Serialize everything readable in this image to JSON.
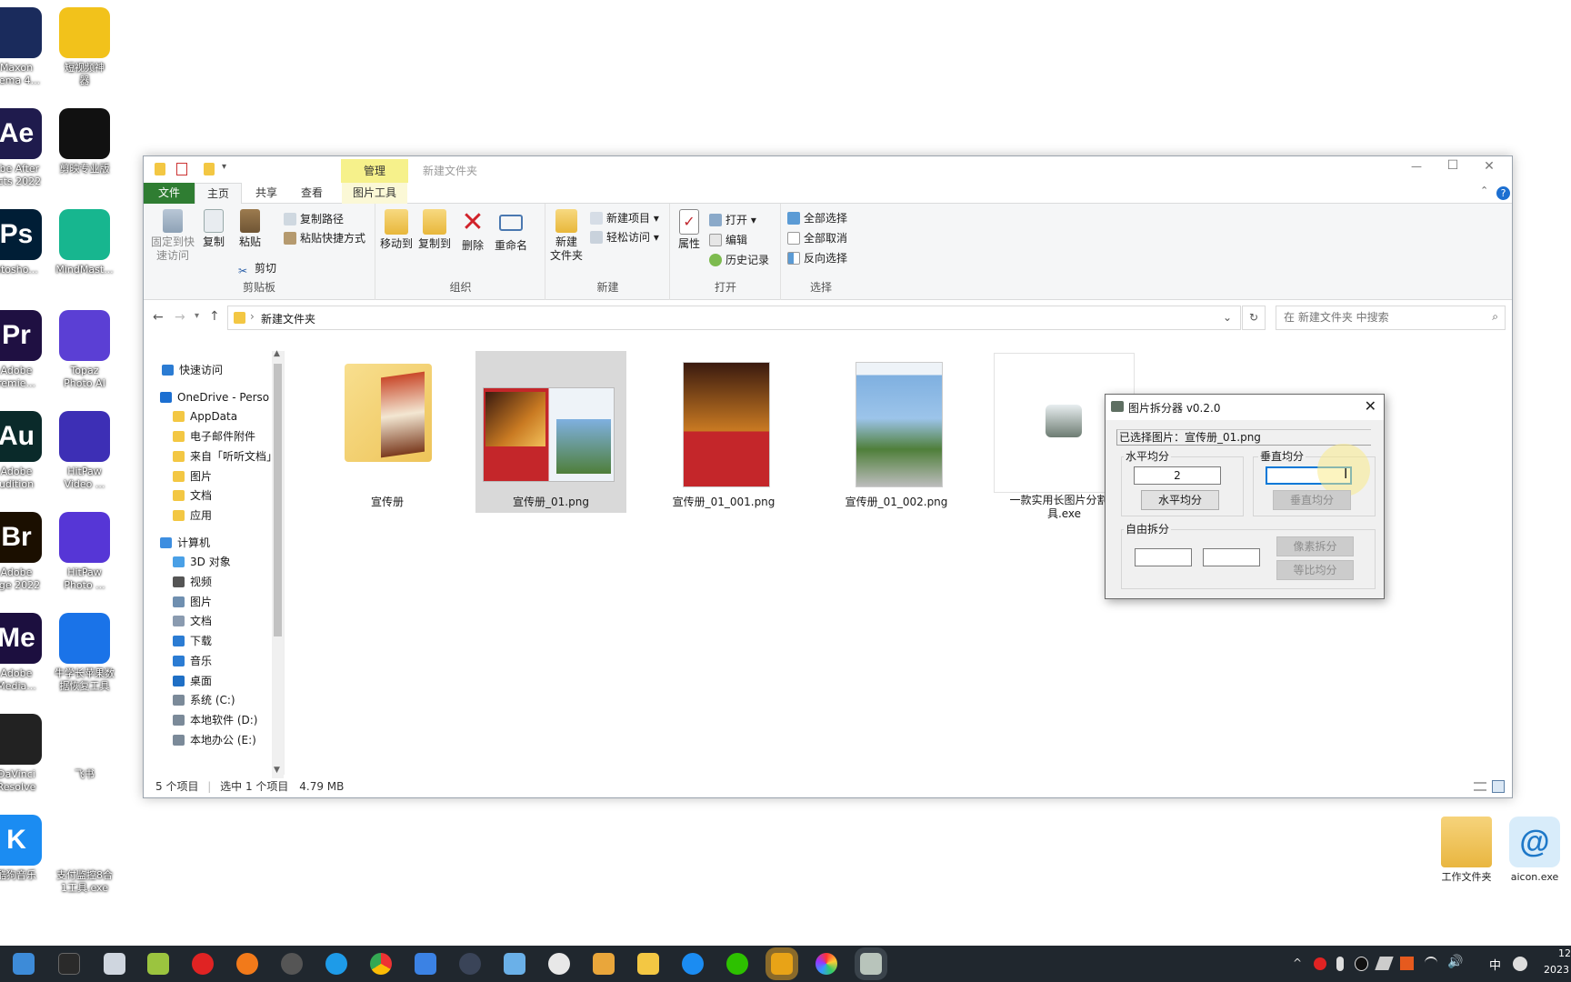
{
  "desktop": {
    "icons": [
      {
        "label": "Maxon\nnema 4...",
        "glyph": "",
        "color": "#1a2b5c"
      },
      {
        "label": "短视频神\n器",
        "glyph": "",
        "color": "#f2c21b"
      },
      {
        "label": "obe After\nects 2022",
        "glyph": "Ae",
        "color": "#1f1b4d"
      },
      {
        "label": "剪映专业版",
        "glyph": "",
        "color": "#111111"
      },
      {
        "label": "otosho...",
        "glyph": "Ps",
        "color": "#001e36"
      },
      {
        "label": "MindMast...",
        "glyph": "",
        "color": "#17b68f"
      },
      {
        "label": "Adobe\nremie...",
        "glyph": "Pr",
        "color": "#1f1042"
      },
      {
        "label": "Topaz\nPhoto AI",
        "glyph": "",
        "color": "#5b3fd4"
      },
      {
        "label": "Adobe\nudition",
        "glyph": "Au",
        "color": "#0a2a2a"
      },
      {
        "label": "HitPaw\nVideo ...",
        "glyph": "",
        "color": "#3d2fb5"
      },
      {
        "label": "Adobe\ndge 2022",
        "glyph": "Br",
        "color": "#1b0f00"
      },
      {
        "label": "HitPaw\nPhoto ...",
        "glyph": "",
        "color": "#5636d6"
      },
      {
        "label": "Adobe\nMedia...",
        "glyph": "Me",
        "color": "#1c0f3f"
      },
      {
        "label": "牛学长苹果数\n据恢复工具",
        "glyph": "",
        "color": "#1a73e8"
      },
      {
        "label": "DaVinci\nResolve",
        "glyph": "",
        "color": "#222222"
      },
      {
        "label": "飞书",
        "glyph": "",
        "color": "#ffffff"
      },
      {
        "label": "酷狗音乐",
        "glyph": "K",
        "color": "#1b8cf2"
      },
      {
        "label": "支付监控8合\n1工具.exe",
        "glyph": "",
        "color": "#ffffff"
      }
    ],
    "right_icons": [
      {
        "label": "工作文件夹"
      },
      {
        "label": "aicon.exe"
      }
    ]
  },
  "explorer": {
    "title": "新建文件夹",
    "context_tab": "管理",
    "window_buttons": {
      "minimize": "—",
      "maximize": "☐",
      "close": "✕"
    },
    "tabs": [
      "文件",
      "主页",
      "共享",
      "查看",
      "图片工具"
    ],
    "ribbon": {
      "clipboard": {
        "group": "剪贴板",
        "pin": "固定到快\n速访问",
        "copy": "复制",
        "paste": "粘贴",
        "copy_path": "复制路径",
        "paste_shortcut": "粘贴快捷方式",
        "cut": "剪切"
      },
      "organize": {
        "group": "组织",
        "move_to": "移动到",
        "copy_to": "复制到",
        "delete": "删除",
        "rename": "重命名"
      },
      "new": {
        "group": "新建",
        "new_folder": "新建\n文件夹",
        "new_item": "新建项目",
        "easy_access": "轻松访问"
      },
      "open": {
        "group": "打开",
        "properties": "属性",
        "open": "打开",
        "edit": "编辑",
        "history": "历史记录"
      },
      "select": {
        "group": "选择",
        "select_all": "全部选择",
        "select_none": "全部取消",
        "invert": "反向选择"
      }
    },
    "address": {
      "path": "新建文件夹",
      "search_placeholder": "在 新建文件夹 中搜索"
    },
    "nav": [
      {
        "label": "快速访问",
        "indent": 1,
        "color": "#2b7cd3"
      },
      {
        "label": "OneDrive - Perso",
        "indent": 0,
        "color": "#1c6fd1"
      },
      {
        "label": "AppData",
        "indent": 1,
        "color": "#f3c743"
      },
      {
        "label": "电子邮件附件",
        "indent": 1,
        "color": "#f3c743"
      },
      {
        "label": "来自「听听文档」",
        "indent": 1,
        "color": "#f3c743"
      },
      {
        "label": "图片",
        "indent": 1,
        "color": "#f3c743"
      },
      {
        "label": "文档",
        "indent": 1,
        "color": "#f3c743"
      },
      {
        "label": "应用",
        "indent": 1,
        "color": "#f3c743"
      },
      {
        "label": "计算机",
        "indent": 0,
        "color": "#3d8ee0"
      },
      {
        "label": "3D 对象",
        "indent": 1,
        "color": "#4aa0e6"
      },
      {
        "label": "视频",
        "indent": 1,
        "color": "#555555"
      },
      {
        "label": "图片",
        "indent": 1,
        "color": "#6f8fb0"
      },
      {
        "label": "文档",
        "indent": 1,
        "color": "#8a9bb0"
      },
      {
        "label": "下载",
        "indent": 1,
        "color": "#2b7cd3"
      },
      {
        "label": "音乐",
        "indent": 1,
        "color": "#2b7cd3"
      },
      {
        "label": "桌面",
        "indent": 1,
        "color": "#1f6fc5"
      },
      {
        "label": "系统 (C:)",
        "indent": 1,
        "color": "#7b8a99"
      },
      {
        "label": "本地软件 (D:)",
        "indent": 1,
        "color": "#7b8a99"
      },
      {
        "label": "本地办公 (E:)",
        "indent": 1,
        "color": "#7b8a99"
      }
    ],
    "files": [
      {
        "name": "宣传册",
        "kind": "folder",
        "selected": false
      },
      {
        "name": "宣传册_01.png",
        "kind": "image-wide",
        "selected": true
      },
      {
        "name": "宣传册_01_001.png",
        "kind": "image-red",
        "selected": false
      },
      {
        "name": "宣传册_01_002.png",
        "kind": "image-blue",
        "selected": false
      },
      {
        "name": "一款实用长图片分割工\n具.exe",
        "kind": "exe",
        "selected": false
      }
    ],
    "status": {
      "count": "5 个项目",
      "selected": "选中 1 个项目",
      "size": "4.79 MB"
    }
  },
  "splitter": {
    "title": "图片拆分器 v0.2.0",
    "selected_label": "已选择图片：宣传册_01.png",
    "horizontal": {
      "group": "水平均分",
      "value": "2",
      "button": "水平均分"
    },
    "vertical": {
      "group": "垂直均分",
      "value": "",
      "button": "垂直均分"
    },
    "free": {
      "group": "自由拆分",
      "value1": "",
      "value2": "",
      "pixel_button": "像素拆分",
      "ratio_button": "等比均分"
    }
  },
  "taskbar": {
    "tray": {
      "ime": "中",
      "time": "12",
      "date": "2023"
    }
  }
}
